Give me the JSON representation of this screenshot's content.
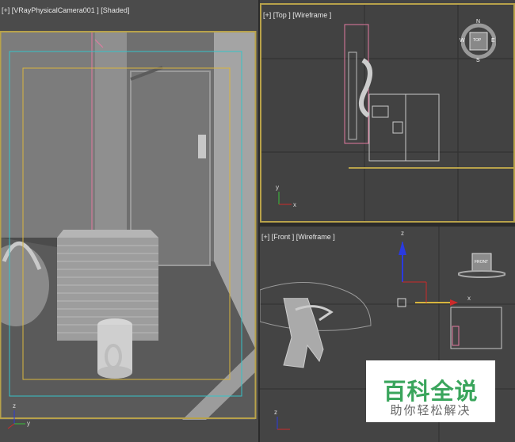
{
  "viewports": {
    "camera": {
      "label": "[+] [VRayPhysicalCamera001 ] [Shaded]"
    },
    "top": {
      "label": "[+] [Top ] [Wireframe ]",
      "cube_label": "TOP",
      "compass": {
        "n": "N",
        "s": "S",
        "e": "E",
        "w": "W"
      }
    },
    "front": {
      "label": "[+] [Front ] [Wireframe ]",
      "cube_label": "FRONT",
      "axis_x": "x",
      "axis_z": "z"
    }
  },
  "axis_labels": {
    "x": "x",
    "y": "y",
    "z": "z"
  },
  "watermark": {
    "title": "百科全说",
    "subtitle": "助你轻松解决"
  },
  "colors": {
    "active_border": "#b8a24a",
    "safe_frame": "#35c3c8",
    "inner_frame": "#d8b53e",
    "wire_pink": "#e37aa0",
    "axis_x": "#cc2a2a",
    "axis_y": "#3ac13a",
    "axis_z": "#2a3ae0",
    "wm_green": "#3aa55c"
  }
}
